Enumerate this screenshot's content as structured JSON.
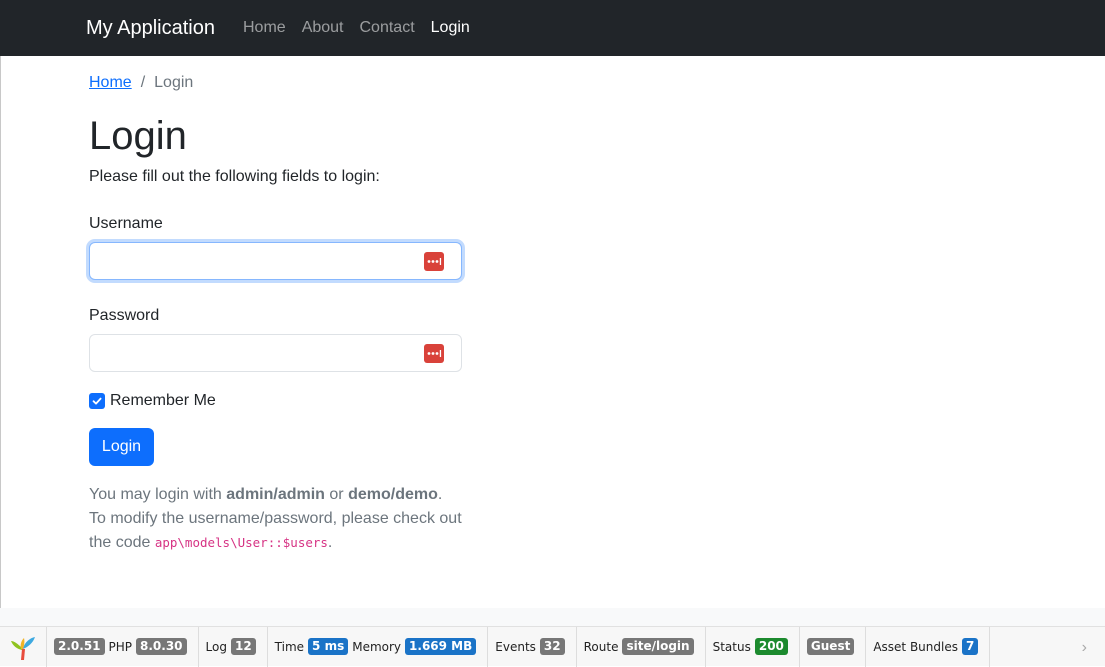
{
  "navbar": {
    "brand": "My Application",
    "links": [
      {
        "label": "Home",
        "active": false
      },
      {
        "label": "About",
        "active": false
      },
      {
        "label": "Contact",
        "active": false
      },
      {
        "label": "Login",
        "active": true
      }
    ]
  },
  "breadcrumb": {
    "home": "Home",
    "separator": "/",
    "current": "Login"
  },
  "page": {
    "title": "Login",
    "intro": "Please fill out the following fields to login:"
  },
  "form": {
    "username_label": "Username",
    "username_value": "",
    "password_label": "Password",
    "password_value": "",
    "remember_label": "Remember Me",
    "remember_checked": true,
    "submit_label": "Login",
    "password_manager_icon": "password-manager-icon"
  },
  "hint": {
    "line1_prefix": "You may login with ",
    "cred1": "admin/admin",
    "line1_mid": " or ",
    "cred2": "demo/demo",
    "line1_suffix": ".",
    "line2": "To modify the username/password, please check out the code ",
    "code": "app\\models\\User::$users",
    "line2_suffix": "."
  },
  "debug_toolbar": {
    "yii_version": "2.0.51",
    "php_label": "PHP",
    "php_version": "8.0.30",
    "log_label": "Log",
    "log_count": "12",
    "time_label": "Time",
    "time_value": "5 ms",
    "memory_label": "Memory",
    "memory_value": "1.669 MB",
    "events_label": "Events",
    "events_count": "32",
    "route_label": "Route",
    "route_value": "site/login",
    "status_label": "Status",
    "status_value": "200",
    "user_value": "Guest",
    "bundles_label": "Asset Bundles",
    "bundles_count": "7",
    "colors": {
      "gray": "#777777",
      "blue": "#1a73c7",
      "green": "#1c8a2e"
    }
  },
  "colors": {
    "navbar": "#212529",
    "primary": "#0d6efd",
    "muted": "#6c757d",
    "code": "#d63384"
  }
}
